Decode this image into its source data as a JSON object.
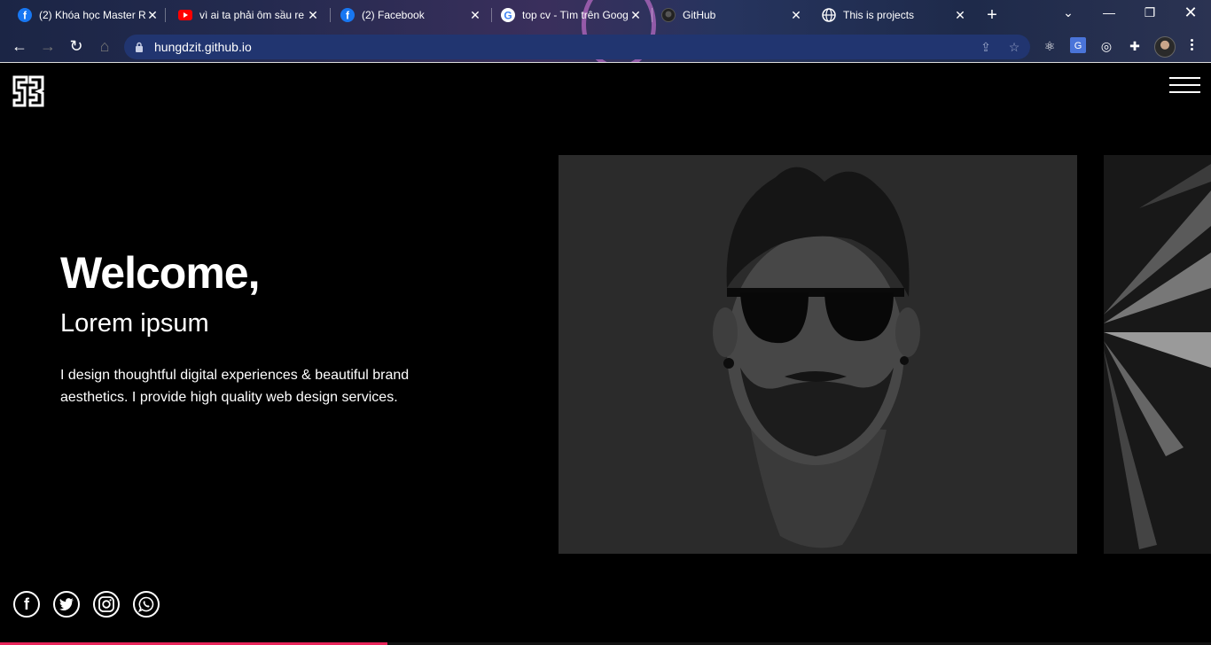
{
  "browser": {
    "tabs": [
      {
        "title": "(2) Khóa học Master R",
        "favicon": "facebook-icon"
      },
      {
        "title": "vì ai ta phải ôm sầu re",
        "favicon": "youtube-icon"
      },
      {
        "title": "(2) Facebook",
        "favicon": "facebook-icon"
      },
      {
        "title": "top cv - Tìm trên Goog",
        "favicon": "google-icon"
      },
      {
        "title": "GitHub",
        "favicon": "github-icon"
      },
      {
        "title": "This is projects",
        "favicon": "globe-icon",
        "active": true
      }
    ],
    "url": "hungdzit.github.io"
  },
  "page": {
    "welcome": "Welcome,",
    "subtitle": "Lorem ipsum",
    "description": "I design thoughtful digital experiences & beautiful brand aesthetics. I provide high quality web design services.",
    "socials": [
      "facebook-icon",
      "twitter-icon",
      "instagram-icon",
      "whatsapp-icon"
    ],
    "accent": "#e8245a",
    "scroll_progress_percent": 32
  }
}
